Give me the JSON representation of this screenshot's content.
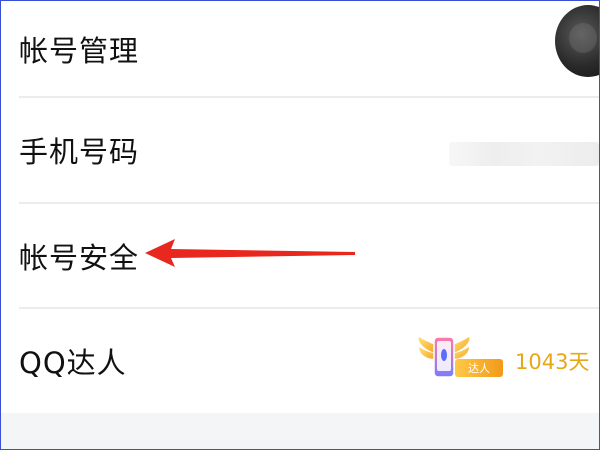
{
  "settings": {
    "rows": [
      {
        "label": "帐号管理"
      },
      {
        "label": "手机号码"
      },
      {
        "label": "帐号安全"
      },
      {
        "label": "QQ达人",
        "badge_text": "达人",
        "days": "1043天"
      }
    ]
  },
  "icons": {
    "avatar": "user-avatar",
    "annotation": "red-arrow-icon",
    "badge": "qq-master-badge-icon"
  },
  "colors": {
    "arrow": "#e8281e",
    "days_text": "#e6a817",
    "divider": "#ececec"
  }
}
